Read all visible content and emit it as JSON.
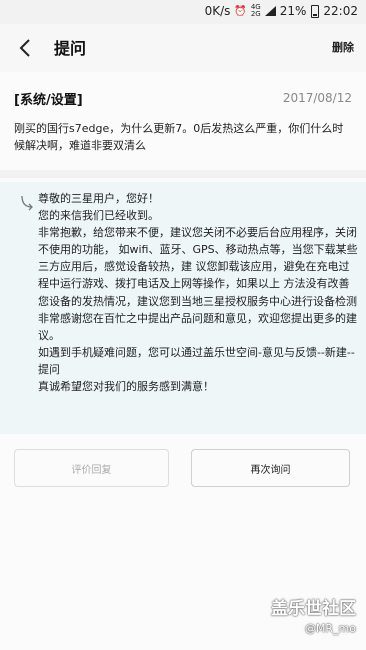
{
  "status_bar": {
    "speed": "0K/s",
    "alarm_icon": "alarm-icon",
    "network_top": "4G",
    "network_bottom": "2G",
    "battery": "21%",
    "time": "22:02"
  },
  "header": {
    "title": "提问",
    "delete_label": "删除"
  },
  "question": {
    "category": "[系统/设置]",
    "date": "2017/08/12",
    "body": "刚买的国行s7edge，为什么更新7。0后发热这么严重，你们什么时候解决啊，难道非要双清么"
  },
  "reply": {
    "lines": [
      "尊敬的三星用户，您好！",
      "您的来信我们已经收到。",
      "非常抱歉，给您带来不便，建议您关闭不必要后台应用程序，关闭不使用的功能， 如wifi、蓝牙、GPS、移动热点等，当您下载某些三方应用后，感觉设备较热，建 议您卸载该应用，避免在充电过程中运行游戏、拨打电话及上网等操作，如果以上 方法没有改善您设备的发热情况，建议您到当地三星授权服务中心进行设备检测",
      "非常感谢您在百忙之中提出产品问题和意见，欢迎您提出更多的建议。",
      "如遇到手机疑难问题，您可以通过盖乐世空间-意见与反馈--新建--提问",
      "真诚希望您对我们的服务感到满意！"
    ]
  },
  "actions": {
    "evaluate_label": "评价回复",
    "ask_again_label": "再次询问"
  },
  "watermark": {
    "title": "盖乐世社区",
    "user": "@MR_mo"
  }
}
